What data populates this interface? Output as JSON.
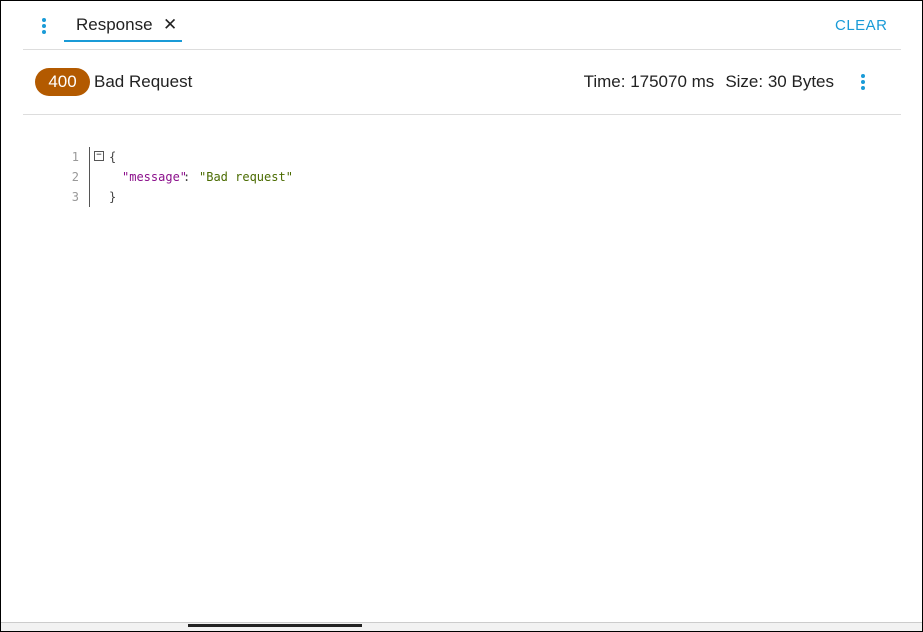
{
  "tabs": {
    "active": {
      "label": "Response",
      "close_glyph": "✕"
    },
    "menu_icon": "kebab-vertical-icon",
    "clear_label": "CLEAR"
  },
  "status": {
    "code": "400",
    "text": "Bad Request",
    "time_label": "Time:",
    "time_value": "175070 ms",
    "size_label": "Size:",
    "size_value": "30 Bytes",
    "badge_color": "#b35a00",
    "menu_icon": "kebab-vertical-icon"
  },
  "response_body": {
    "lines": [
      {
        "number": "1",
        "text": "{"
      },
      {
        "number": "2",
        "key": "\"message\"",
        "separator": ": ",
        "value": "\"Bad request\""
      },
      {
        "number": "3",
        "text": "}"
      }
    ],
    "fold_glyph": "−"
  },
  "colors": {
    "accent": "#1a9bd7",
    "json_key": "#8b0f8b",
    "json_string": "#4a6b00"
  }
}
